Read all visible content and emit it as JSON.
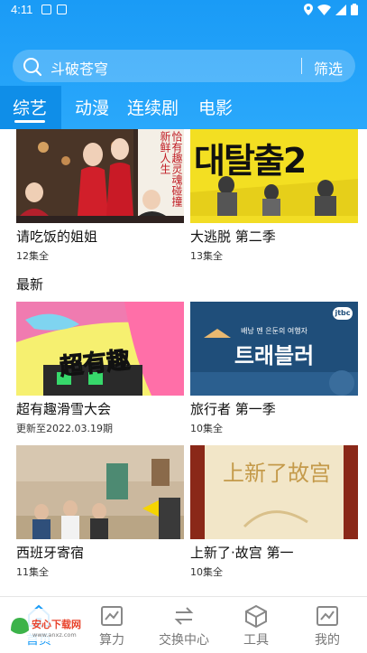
{
  "status": {
    "time": "4:11"
  },
  "search": {
    "query": "斗破苍穹",
    "filter_label": "筛选"
  },
  "tabs": [
    {
      "label": "综艺",
      "active": true
    },
    {
      "label": "动漫",
      "active": false
    },
    {
      "label": "连续剧",
      "active": false
    },
    {
      "label": "电影",
      "active": false
    }
  ],
  "top_row": [
    {
      "title": "请吃饭的姐姐",
      "sub": "12集全",
      "thumb_text": "恰有趣灵魂碰撞新鲜人生"
    },
    {
      "title": "大逃脱 第二季",
      "sub": "13集全",
      "thumb_text": "대탈출2"
    }
  ],
  "section": {
    "title": "最新"
  },
  "latest": [
    {
      "title": "超有趣滑雪大会",
      "sub": "更新至2022.03.19期",
      "thumb_text": "超有趣"
    },
    {
      "title": "旅行者 第一季",
      "sub": "10集全",
      "thumb_text": "트래블러",
      "thumb_small": "배낭 멘 은둔의 여행자",
      "badge": "jtbc"
    },
    {
      "title": "西班牙寄宿",
      "sub": "11集全"
    },
    {
      "title": "上新了·故宫 第一",
      "sub": "10集全",
      "thumb_text": "上新了故宫"
    }
  ],
  "nav": [
    {
      "label": "首页",
      "icon": "home-icon",
      "active": true
    },
    {
      "label": "算力",
      "icon": "chart-icon",
      "active": false
    },
    {
      "label": "交换中心",
      "icon": "exchange-icon",
      "active": false
    },
    {
      "label": "工具",
      "icon": "box-icon",
      "active": false
    },
    {
      "label": "我的",
      "icon": "profile-icon",
      "active": false
    }
  ],
  "watermark": {
    "brand": "安心下载网",
    "url": "www.anxz.com"
  },
  "colors": {
    "primary": "#1a9bf6",
    "tab_active_bg": "#0f8ee8"
  }
}
